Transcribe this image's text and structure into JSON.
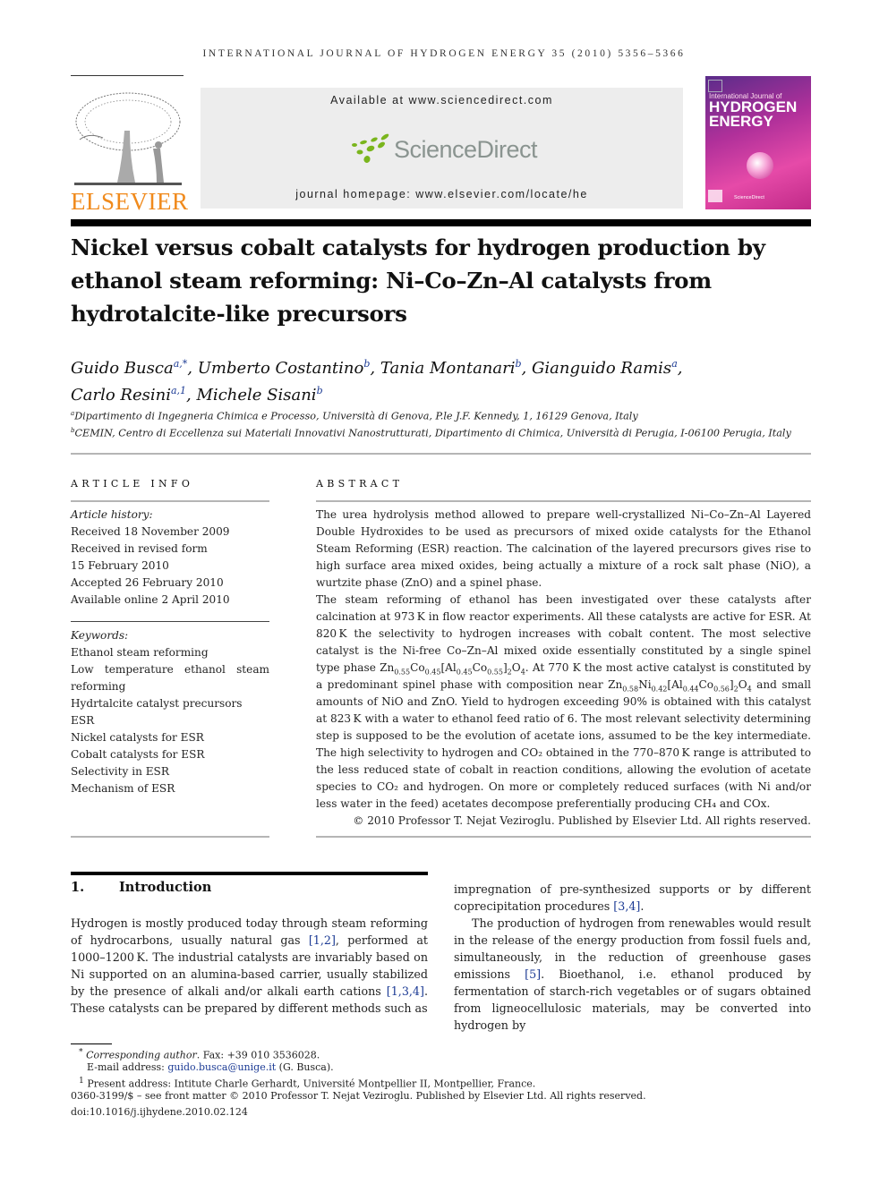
{
  "header": {
    "running_head": "INTERNATIONAL JOURNAL OF HYDROGEN ENERGY 35 (2010) 5356–5366",
    "publisher_logo_text": "ELSEVIER",
    "available_at": "Available at www.sciencedirect.com",
    "sd_logo_text": "ScienceDirect",
    "journal_homepage": "journal homepage: www.elsevier.com/locate/he",
    "cover": {
      "line1": "International Journal of",
      "line2": "HYDROGEN",
      "line3": "ENERGY",
      "footer": "ScienceDirect"
    },
    "colors": {
      "elsevier_orange": "#f08a1c",
      "sd_green": "#7ab51d",
      "link_blue": "#1b3a94"
    }
  },
  "article": {
    "title": "Nickel versus cobalt catalysts for hydrogen production by ethanol steam reforming: Ni–Co–Zn–Al catalysts from hydrotalcite-like precursors",
    "authors": [
      {
        "name": "Guido Busca",
        "sup": "a,*"
      },
      {
        "name": "Umberto Costantino",
        "sup": "b"
      },
      {
        "name": "Tania Montanari",
        "sup": "b"
      },
      {
        "name": "Gianguido Ramis",
        "sup": "a"
      },
      {
        "name": "Carlo Resini",
        "sup": "a,1"
      },
      {
        "name": "Michele Sisani",
        "sup": "b"
      }
    ],
    "affiliations": [
      {
        "mark": "a",
        "text": "Dipartimento di Ingegneria Chimica e Processo, Università di Genova, P.le J.F. Kennedy, 1, 16129 Genova, Italy"
      },
      {
        "mark": "b",
        "text": "CEMIN, Centro di Eccellenza sui Materiali Innovativi Nanostrutturati, Dipartimento di Chimica, Università di Perugia, I-06100 Perugia, Italy"
      }
    ]
  },
  "article_info": {
    "label": "ARTICLE INFO",
    "history_label": "Article history:",
    "history": [
      "Received 18 November 2009",
      "Received in revised form",
      "15 February 2010",
      "Accepted 26 February 2010",
      "Available online 2 April 2010"
    ],
    "keywords_label": "Keywords:",
    "keywords": [
      "Ethanol steam reforming",
      "Low temperature ethanol steam reforming",
      "Hydrtalcite catalyst precursors",
      "ESR",
      "Nickel catalysts for ESR",
      "Cobalt catalysts for ESR",
      "Selectivity in ESR",
      "Mechanism of ESR"
    ]
  },
  "abstract": {
    "label": "ABSTRACT",
    "p1": "The urea hydrolysis method allowed to prepare well-crystallized Ni–Co–Zn–Al Layered Double Hydroxides to be used as precursors of mixed oxide catalysts for the Ethanol Steam Reforming (ESR) reaction. The calcination of the layered precursors gives rise to high surface area mixed oxides, being actually a mixture of a rock salt phase (NiO), a wurtzite phase (ZnO) and a spinel phase.",
    "p2_a": "The steam reforming of ethanol has been investigated over these catalysts after calcination at 973 K in flow reactor experiments. All these catalysts are active for ESR. At 820 K the selectivity to hydrogen increases with cobalt content. The most selective catalyst is the Ni-free Co–Zn–Al mixed oxide essentially constituted by a single spinel type phase ",
    "formula1": "Zn0.55Co0.45[Al0.45Co0.55]2O4",
    "p2_b": ". At 770 K the most active catalyst is constituted by a predominant spinel phase with composition near ",
    "formula2": "Zn0.58Ni0.42[Al0.44Co0.56]2O4",
    "p2_c": " and small amounts of NiO and ZnO. Yield to hydrogen exceeding 90% is obtained with this catalyst at 823 K with a water to ethanol feed ratio of 6. The most relevant selectivity determining step is supposed to be the evolution of acetate ions, assumed to be the key intermediate. The high selectivity to hydrogen and CO₂ obtained in the 770–870 K range is attributed to the less reduced state of cobalt in reaction conditions, allowing the evolution of acetate species to CO₂ and hydrogen. On more or completely reduced surfaces (with Ni and/or less water in the feed) acetates decompose preferentially producing CH₄ and COx.",
    "copyright": "© 2010 Professor T. Nejat Veziroglu. Published by Elsevier Ltd. All rights reserved."
  },
  "intro": {
    "number": "1.",
    "heading": "Introduction",
    "left": {
      "t1": "Hydrogen is mostly produced today through steam reforming of hydrocarbons, usually natural gas ",
      "r1": "[1,2]",
      "t2": ", performed at 1000–1200 K. The industrial catalysts are invariably based on Ni supported on an alumina-based carrier, usually stabilized by the presence of alkali and/or alkali earth cations ",
      "r2": "[1,3,4]",
      "t3": ". These catalysts can be prepared by different methods such as"
    },
    "right": {
      "t1": "impregnation of pre-synthesized supports or by different coprecipitation procedures ",
      "r1": "[3,4]",
      "t2": ".",
      "p2a": "The production of hydrogen from renewables would result in the release of the energy production from fossil fuels and, simultaneously, in the reduction of greenhouse gases emissions ",
      "r2": "[5]",
      "p2b": ". Bioethanol, i.e. ethanol produced by fermentation of starch-rich vegetables or of sugars obtained from ligneocellulosic materials, may be converted into hydrogen by"
    }
  },
  "footnotes": {
    "corr_mark": "*",
    "corr_label": "Corresponding author",
    "corr_text": ". Fax: +39 010 3536028.",
    "email_label": "E-mail address: ",
    "email": "guido.busca@unige.it",
    "email_suffix": " (G. Busca).",
    "present_mark": "1",
    "present_text": "Present address: Intitute Charle Gerhardt, Université Montpellier II, Montpellier, France.",
    "issn": "0360-3199/$ – see front matter © 2010 Professor T. Nejat Veziroglu. Published by Elsevier Ltd. All rights reserved.",
    "doi": "doi:10.1016/j.ijhydene.2010.02.124"
  }
}
